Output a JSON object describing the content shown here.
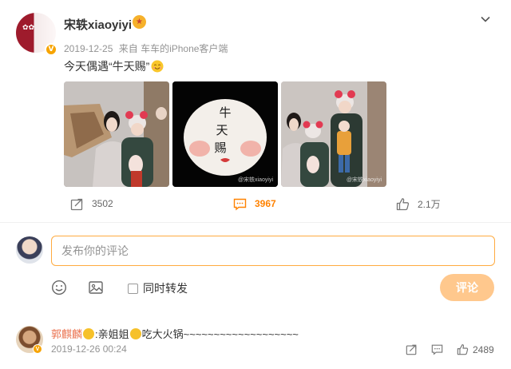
{
  "post": {
    "author": "宋轶xiaoyiyi",
    "verified_badge": "V",
    "date": "2019-12-25",
    "source": "来自 车车的iPhone客户端",
    "text": "今天偶遇“牛天赐”",
    "images": [
      {
        "watermark": ""
      },
      {
        "watermark": "@宋轶xiaoyiyi"
      },
      {
        "watermark": "@宋轶xiaoyiyi"
      }
    ],
    "icons": {
      "more": "chevron-down-icon",
      "medal": "medal-icon",
      "emoji": "smile-emoji-icon"
    }
  },
  "actions": {
    "repost_count": "3502",
    "comment_count": "3967",
    "like_count": "2.1万",
    "accent": "#ff8200"
  },
  "composer": {
    "placeholder": "发布你的评论",
    "also_repost": "同时转发",
    "submit": "评论",
    "border_color": "#ffab40",
    "submit_color": "#ffc88d"
  },
  "comments": [
    {
      "user": "郭麒麟",
      "text_a": "亲姐姐",
      "text_b": "吃大火锅~~~~~~~~~~~~~~~~~~~",
      "time": "2019-12-26 00:24",
      "likes": "2489",
      "user_color": "#eb7350"
    }
  ]
}
